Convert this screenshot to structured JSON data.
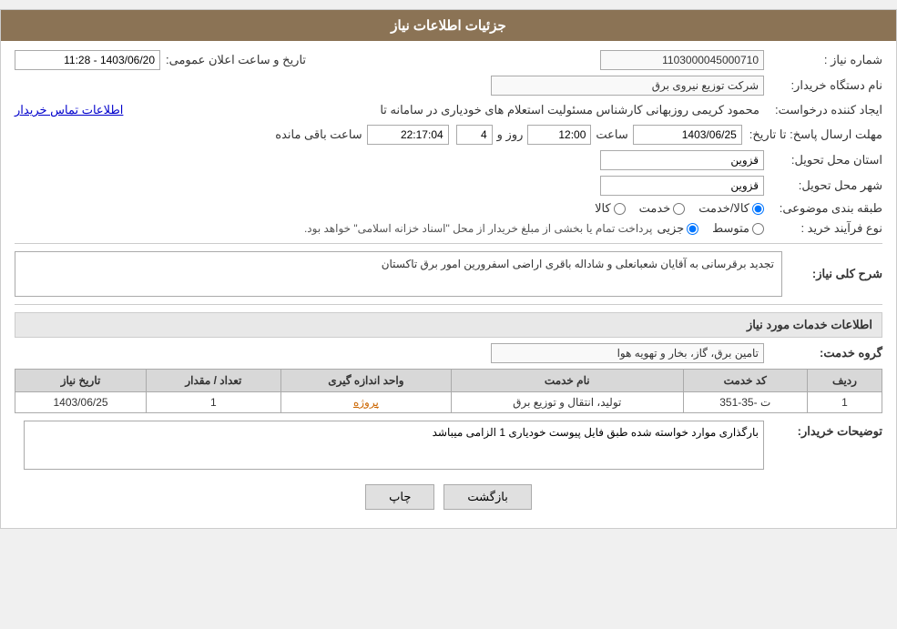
{
  "header": {
    "title": "جزئیات اطلاعات نیاز"
  },
  "fields": {
    "shomareNiaz_label": "شماره نیاز :",
    "shomareNiaz_value": "1103000045000710",
    "namDastgah_label": "نام دستگاه خریدار:",
    "namDastgah_value": "شرکت توزیع نیروی برق",
    "ijadKonande_label": "ایجاد کننده درخواست:",
    "ijadKonande_value": "محمود کریمی روزبهانی کارشناس  مسئولیت استعلام های خودیاری در سامانه تا",
    "ijadKonande_link": "اطلاعات تماس خریدار",
    "mohlatErsal_label": "مهلت ارسال پاسخ: تا تاریخ:",
    "mohlatDate": "1403/06/25",
    "mohlatSaat_label": "ساعت",
    "mohlatSaat_value": "12:00",
    "mohlatRooz_label": "روز و",
    "mohlatRooz_value": "4",
    "baghimandeSaat_label": "ساعت باقی مانده",
    "baghimandeSaat_value": "22:17:04",
    "ostan_label": "استان محل تحویل:",
    "ostan_value": "قزوین",
    "shahr_label": "شهر محل تحویل:",
    "shahr_value": "قزوین",
    "tarifeBandi_label": "طبقه بندی موضوعی:",
    "tarife_kala": "کالا",
    "tarife_khadamat": "خدمت",
    "tarife_kala_khadamat": "کالا/خدمت",
    "tarife_selected": "kala_khadamat",
    "noeFaraind_label": "نوع فرآیند خرید :",
    "noeFaraind_jazii": "جزیی",
    "noeFaraind_motavassit": "متوسط",
    "noeFaraind_note": "پرداخت تمام یا بخشی از مبلغ خریدار از محل \"اسناد خزانه اسلامی\" خواهد بود.",
    "noeFaraind_selected": "jazii",
    "sharhKoli_label": "شرح کلی نیاز:",
    "sharhKoli_value": "تجدید برقرسانی به آقایان شعبانعلی و شاداله باقری اراضی اسفرورین امور برق تاکستان",
    "section_khadamat": "اطلاعات خدمات مورد نیاز",
    "goroheKhadamat_label": "گروه خدمت:",
    "goroheKhadamat_value": "تامین برق، گاز، بخار و تهویه هوا",
    "table": {
      "headers": [
        "ردیف",
        "کد خدمت",
        "نام خدمت",
        "واحد اندازه گیری",
        "تعداد / مقدار",
        "تاریخ نیاز"
      ],
      "rows": [
        {
          "radif": "1",
          "kodKhadamat": "ت -35-351",
          "namKhadamat": "تولید، انتقال و توزیع برق",
          "vahed": "پروژه",
          "tedad": "1",
          "tarikh": "1403/06/25"
        }
      ]
    },
    "toozihat_label": "توضیحات خریدار:",
    "toozihat_value": "بارگذاری موارد خواسته شده طبق فایل پیوست خودیاری 1 الزامی میباشد",
    "tarikhErsal_label": "تاریخ و ساعت اعلان عمومی:",
    "tarikhErsal_value": "1403/06/20 - 11:28"
  },
  "buttons": {
    "print_label": "چاپ",
    "back_label": "بازگشت"
  }
}
